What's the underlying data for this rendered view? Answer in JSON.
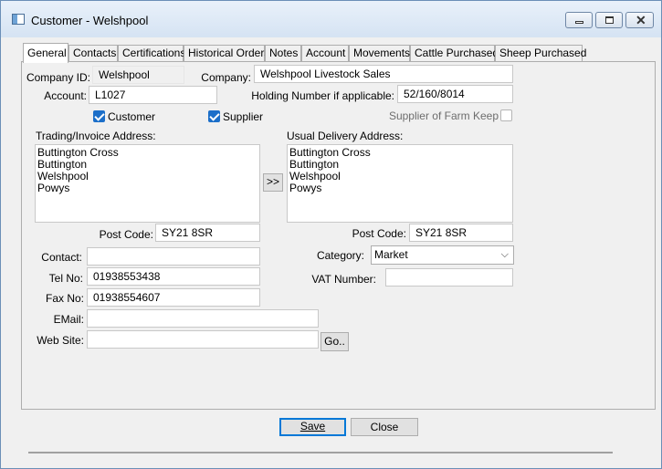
{
  "window": {
    "title": "Customer - Welshpool"
  },
  "tabs": [
    "General",
    "Contacts",
    "Certifications",
    "Historical Orders",
    "Notes",
    "Account",
    "Movements",
    "Cattle Purchased",
    "Sheep Purchased"
  ],
  "form": {
    "company_id_label": "Company ID:",
    "company_id": "Welshpool",
    "company_label": "Company:",
    "company": "Welshpool Livestock Sales",
    "account_label": "Account:",
    "account": "L1027",
    "holding_label": "Holding Number if applicable:",
    "holding": "52/160/8014",
    "customer_label": "Customer",
    "supplier_label": "Supplier",
    "farm_keep_label": "Supplier of Farm Keep",
    "trading_label": "Trading/Invoice Address:",
    "trading_address": [
      "Buttington Cross",
      "Buttington",
      "Welshpool",
      "Powys"
    ],
    "copy_button": ">>",
    "delivery_label": "Usual Delivery Address:",
    "delivery_address": [
      "Buttington Cross",
      "Buttington",
      "Welshpool",
      "Powys"
    ],
    "postcode_label": "Post Code:",
    "trading_postcode": "SY21 8SR",
    "delivery_postcode": "SY21 8SR",
    "contact_label": "Contact:",
    "contact": "",
    "category_label": "Category:",
    "category": "Market",
    "tel_label": "Tel No:",
    "tel": "01938553438",
    "vat_label": "VAT Number:",
    "vat": "",
    "fax_label": "Fax No:",
    "fax": "01938554607",
    "email_label": "EMail:",
    "email": "",
    "website_label": "Web Site:",
    "website": "",
    "go_button": "Go.."
  },
  "buttons": {
    "save": "Save",
    "close": "Close"
  },
  "checks": {
    "customer": true,
    "supplier": true,
    "farm_keep": false
  },
  "colors": {
    "accent": "#1c6fc9"
  }
}
